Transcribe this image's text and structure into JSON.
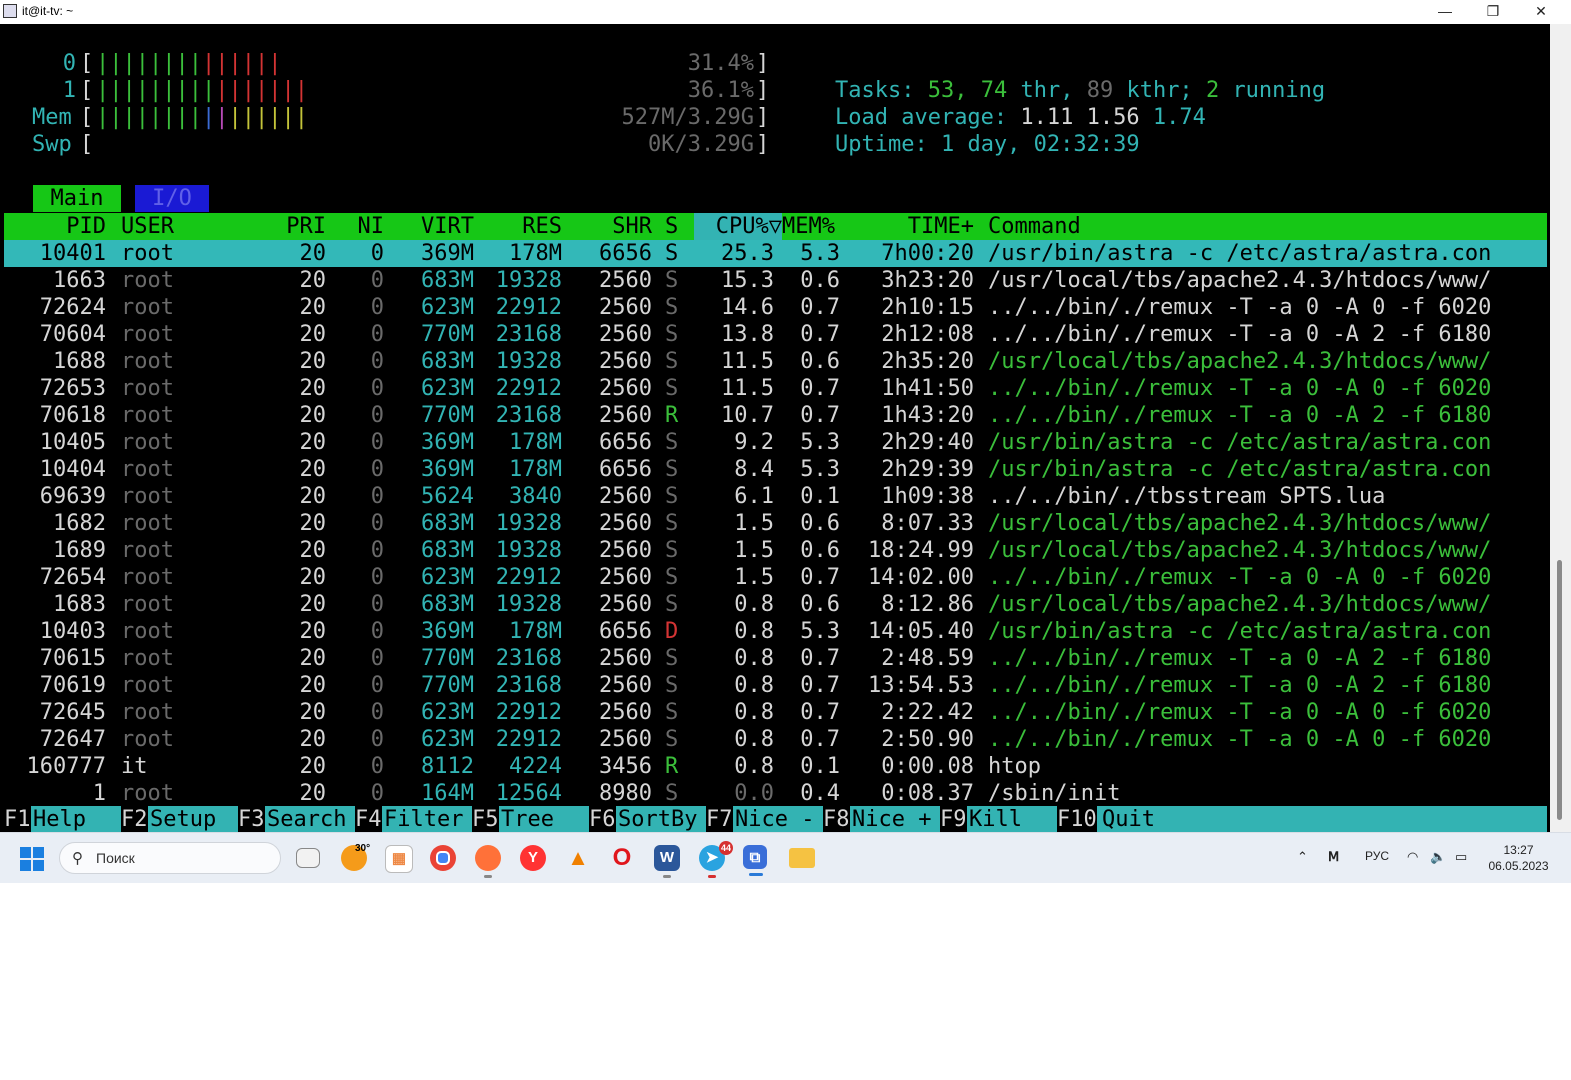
{
  "window": {
    "title": "it@it-tv: ~",
    "controls": [
      "—",
      "❐",
      "✕"
    ]
  },
  "meters": {
    "cpu0": {
      "label": "0",
      "value": "31.4%",
      "fill": 0.314
    },
    "cpu1": {
      "label": "1",
      "value": "36.1%",
      "fill": 0.361
    },
    "mem": {
      "label": "Mem",
      "value": "527M/3.29G"
    },
    "swp": {
      "label": "Swp",
      "value": "0K/3.29G"
    },
    "open_bracket": "[",
    "close_bracket": "]"
  },
  "summary": {
    "tasks_label": "Tasks:",
    "tasks": "53,",
    "thr": "74",
    "thr_label": "thr,",
    "kthr": "89",
    "kthr_label": "kthr;",
    "running": "2",
    "running_label": "running",
    "load_label": "Load average:",
    "load1": "1.11",
    "load5": "1.56",
    "load15": "1.74",
    "uptime_label": "Uptime:",
    "uptime": "1 day, 02:32:39"
  },
  "tabs": {
    "main": "Main",
    "io": "I/O"
  },
  "columns": {
    "pid": "PID",
    "user": "USER",
    "pri": "PRI",
    "ni": "NI",
    "virt": "VIRT",
    "res": "RES",
    "shr": "SHR",
    "s": "S",
    "cpu": "CPU%▽",
    "mem": "MEM%",
    "time": "TIME+",
    "command": "Command"
  },
  "processes": [
    {
      "pid": "10401",
      "user": "root",
      "pri": "20",
      "ni": "0",
      "virt": "369M",
      "res": "178M",
      "shr": "6656",
      "s": "S",
      "cpu": "25.3",
      "mem": "5.3",
      "time": "7h00:20",
      "command": "/usr/bin/astra -c /etc/astra/astra.con"
    },
    {
      "pid": "1663",
      "user": "root",
      "pri": "20",
      "ni": "0",
      "virt": "683M",
      "res": "19328",
      "shr": "2560",
      "s": "S",
      "cpu": "15.3",
      "mem": "0.6",
      "time": "3h23:20",
      "command": "/usr/local/tbs/apache2.4.3/htdocs/www/"
    },
    {
      "pid": "72624",
      "user": "root",
      "pri": "20",
      "ni": "0",
      "virt": "623M",
      "res": "22912",
      "shr": "2560",
      "s": "S",
      "cpu": "14.6",
      "mem": "0.7",
      "time": "2h10:15",
      "command": "../../bin/./remux -T -a 0 -A 0 -f 6020"
    },
    {
      "pid": "70604",
      "user": "root",
      "pri": "20",
      "ni": "0",
      "virt": "770M",
      "res": "23168",
      "shr": "2560",
      "s": "S",
      "cpu": "13.8",
      "mem": "0.7",
      "time": "2h12:08",
      "command": "../../bin/./remux -T -a 0 -A 2 -f 6180"
    },
    {
      "pid": "1688",
      "user": "root",
      "pri": "20",
      "ni": "0",
      "virt": "683M",
      "res": "19328",
      "shr": "2560",
      "s": "S",
      "cpu": "11.5",
      "mem": "0.6",
      "time": "2h35:20",
      "command": "/usr/local/tbs/apache2.4.3/htdocs/www/"
    },
    {
      "pid": "72653",
      "user": "root",
      "pri": "20",
      "ni": "0",
      "virt": "623M",
      "res": "22912",
      "shr": "2560",
      "s": "S",
      "cpu": "11.5",
      "mem": "0.7",
      "time": "1h41:50",
      "command": "../../bin/./remux -T -a 0 -A 0 -f 6020"
    },
    {
      "pid": "70618",
      "user": "root",
      "pri": "20",
      "ni": "0",
      "virt": "770M",
      "res": "23168",
      "shr": "2560",
      "s": "R",
      "cpu": "10.7",
      "mem": "0.7",
      "time": "1h43:20",
      "command": "../../bin/./remux -T -a 0 -A 2 -f 6180"
    },
    {
      "pid": "10405",
      "user": "root",
      "pri": "20",
      "ni": "0",
      "virt": "369M",
      "res": "178M",
      "shr": "6656",
      "s": "S",
      "cpu": "9.2",
      "mem": "5.3",
      "time": "2h29:40",
      "command": "/usr/bin/astra -c /etc/astra/astra.con"
    },
    {
      "pid": "10404",
      "user": "root",
      "pri": "20",
      "ni": "0",
      "virt": "369M",
      "res": "178M",
      "shr": "6656",
      "s": "S",
      "cpu": "8.4",
      "mem": "5.3",
      "time": "2h29:39",
      "command": "/usr/bin/astra -c /etc/astra/astra.con"
    },
    {
      "pid": "69639",
      "user": "root",
      "pri": "20",
      "ni": "0",
      "virt": "5624",
      "res": "3840",
      "shr": "2560",
      "s": "S",
      "cpu": "6.1",
      "mem": "0.1",
      "time": "1h09:38",
      "command": "../../bin/./tbsstream SPTS.lua"
    },
    {
      "pid": "1682",
      "user": "root",
      "pri": "20",
      "ni": "0",
      "virt": "683M",
      "res": "19328",
      "shr": "2560",
      "s": "S",
      "cpu": "1.5",
      "mem": "0.6",
      "time": "8:07.33",
      "command": "/usr/local/tbs/apache2.4.3/htdocs/www/"
    },
    {
      "pid": "1689",
      "user": "root",
      "pri": "20",
      "ni": "0",
      "virt": "683M",
      "res": "19328",
      "shr": "2560",
      "s": "S",
      "cpu": "1.5",
      "mem": "0.6",
      "time": "18:24.99",
      "command": "/usr/local/tbs/apache2.4.3/htdocs/www/"
    },
    {
      "pid": "72654",
      "user": "root",
      "pri": "20",
      "ni": "0",
      "virt": "623M",
      "res": "22912",
      "shr": "2560",
      "s": "S",
      "cpu": "1.5",
      "mem": "0.7",
      "time": "14:02.00",
      "command": "../../bin/./remux -T -a 0 -A 0 -f 6020"
    },
    {
      "pid": "1683",
      "user": "root",
      "pri": "20",
      "ni": "0",
      "virt": "683M",
      "res": "19328",
      "shr": "2560",
      "s": "S",
      "cpu": "0.8",
      "mem": "0.6",
      "time": "8:12.86",
      "command": "/usr/local/tbs/apache2.4.3/htdocs/www/"
    },
    {
      "pid": "10403",
      "user": "root",
      "pri": "20",
      "ni": "0",
      "virt": "369M",
      "res": "178M",
      "shr": "6656",
      "s": "D",
      "cpu": "0.8",
      "mem": "5.3",
      "time": "14:05.40",
      "command": "/usr/bin/astra -c /etc/astra/astra.con"
    },
    {
      "pid": "70615",
      "user": "root",
      "pri": "20",
      "ni": "0",
      "virt": "770M",
      "res": "23168",
      "shr": "2560",
      "s": "S",
      "cpu": "0.8",
      "mem": "0.7",
      "time": "2:48.59",
      "command": "../../bin/./remux -T -a 0 -A 2 -f 6180"
    },
    {
      "pid": "70619",
      "user": "root",
      "pri": "20",
      "ni": "0",
      "virt": "770M",
      "res": "23168",
      "shr": "2560",
      "s": "S",
      "cpu": "0.8",
      "mem": "0.7",
      "time": "13:54.53",
      "command": "../../bin/./remux -T -a 0 -A 2 -f 6180"
    },
    {
      "pid": "72645",
      "user": "root",
      "pri": "20",
      "ni": "0",
      "virt": "623M",
      "res": "22912",
      "shr": "2560",
      "s": "S",
      "cpu": "0.8",
      "mem": "0.7",
      "time": "2:22.42",
      "command": "../../bin/./remux -T -a 0 -A 0 -f 6020"
    },
    {
      "pid": "72647",
      "user": "root",
      "pri": "20",
      "ni": "0",
      "virt": "623M",
      "res": "22912",
      "shr": "2560",
      "s": "S",
      "cpu": "0.8",
      "mem": "0.7",
      "time": "2:50.90",
      "command": "../../bin/./remux -T -a 0 -A 0 -f 6020"
    },
    {
      "pid": "160777",
      "user": "it",
      "pri": "20",
      "ni": "0",
      "virt": "8112",
      "res": "4224",
      "shr": "3456",
      "s": "R",
      "cpu": "0.8",
      "mem": "0.1",
      "time": "0:00.08",
      "command": "htop"
    },
    {
      "pid": "1",
      "user": "root",
      "pri": "20",
      "ni": "0",
      "virt": "164M",
      "res": "12564",
      "shr": "8980",
      "s": "S",
      "cpu": "0.0",
      "mem": "0.4",
      "time": "0:08.37",
      "command": "/sbin/init"
    }
  ],
  "footer": [
    {
      "key": "F1",
      "label": "Help  "
    },
    {
      "key": "F2",
      "label": "Setup "
    },
    {
      "key": "F3",
      "label": "Search"
    },
    {
      "key": "F4",
      "label": "Filter"
    },
    {
      "key": "F5",
      "label": "Tree  "
    },
    {
      "key": "F6",
      "label": "SortBy"
    },
    {
      "key": "F7",
      "label": "Nice -"
    },
    {
      "key": "F8",
      "label": "Nice +"
    },
    {
      "key": "F9",
      "label": "Kill  "
    },
    {
      "key": "F10",
      "label": "Quit"
    }
  ],
  "taskbar": {
    "search_placeholder": "Поиск",
    "weather_temp": "30°",
    "telegram_badge": "44",
    "language": "РУС",
    "time": "13:27",
    "date": "06.05.2023",
    "icons": [
      "windows-start-icon",
      "search-icon",
      "task-view-icon",
      "weather-icon",
      "store-icon",
      "chrome-icon",
      "firefox-icon",
      "yandex-icon",
      "vlc-icon",
      "opera-icon",
      "word-icon",
      "telegram-icon",
      "network-app-icon",
      "file-explorer-icon",
      "tray-chevron-icon",
      "tray-app-icon",
      "wifi-icon",
      "volume-icon",
      "battery-icon"
    ]
  },
  "colors": {
    "terminal_bg": "#000000",
    "header_green": "#16c716",
    "selection_cyan": "#33b8b8",
    "text_cyan": "#32b4b4",
    "text_green": "#3bbf3b",
    "text_red": "#d43434"
  }
}
